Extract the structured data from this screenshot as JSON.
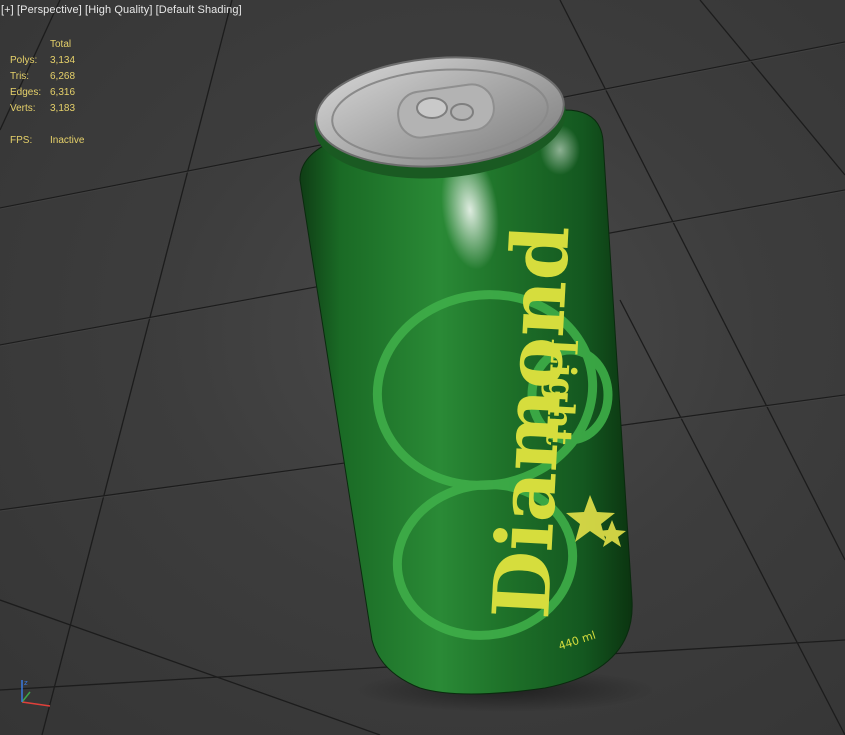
{
  "viewport": {
    "labels": [
      "[+]",
      "[Perspective]",
      "[High Quality]",
      "[Default Shading]"
    ]
  },
  "stats": {
    "header": "Total",
    "rows": [
      {
        "key": "Polys:",
        "value": "3,134"
      },
      {
        "key": "Tris:",
        "value": "6,268"
      },
      {
        "key": "Edges:",
        "value": "6,316"
      },
      {
        "key": "Verts:",
        "value": "3,183"
      }
    ],
    "fps_key": "FPS:",
    "fps_value": "Inactive"
  },
  "can": {
    "brand": "Diamond",
    "sub": "Light",
    "volume": "440 ml",
    "color": "#1f7a2c",
    "text_color": "#d8e040"
  },
  "gizmo": {
    "axes": [
      "x",
      "y",
      "z"
    ]
  }
}
